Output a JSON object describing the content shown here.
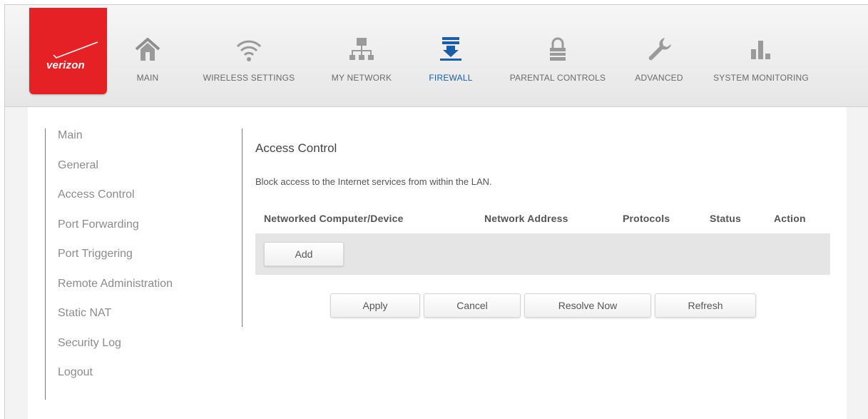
{
  "brand": {
    "logo_text": "verizon",
    "accent": "#e52125"
  },
  "nav": {
    "items": [
      {
        "label": "MAIN",
        "icon": "home-icon"
      },
      {
        "label": "WIRELESS SETTINGS",
        "icon": "wifi-icon"
      },
      {
        "label": "MY NETWORK",
        "icon": "network-icon"
      },
      {
        "label": "FIREWALL",
        "icon": "firewall-icon",
        "active": true
      },
      {
        "label": "PARENTAL CONTROLS",
        "icon": "lock-icon"
      },
      {
        "label": "ADVANCED",
        "icon": "wrench-icon"
      },
      {
        "label": "SYSTEM MONITORING",
        "icon": "bar-chart-icon"
      }
    ],
    "active_color": "#1b5da8"
  },
  "sidebar": {
    "items": [
      {
        "label": "Main"
      },
      {
        "label": "General"
      },
      {
        "label": "Access Control"
      },
      {
        "label": "Port Forwarding"
      },
      {
        "label": "Port Triggering"
      },
      {
        "label": "Remote Administration"
      },
      {
        "label": "Static NAT"
      },
      {
        "label": "Security Log"
      },
      {
        "label": "Logout"
      }
    ]
  },
  "main": {
    "title": "Access Control",
    "description": "Block access to the Internet services from within the LAN.",
    "table": {
      "columns": [
        "Networked Computer/Device",
        "Network Address",
        "Protocols",
        "Status",
        "Action"
      ],
      "add_label": "Add"
    },
    "buttons": {
      "apply": "Apply",
      "cancel": "Cancel",
      "resolve": "Resolve Now",
      "refresh": "Refresh"
    }
  }
}
